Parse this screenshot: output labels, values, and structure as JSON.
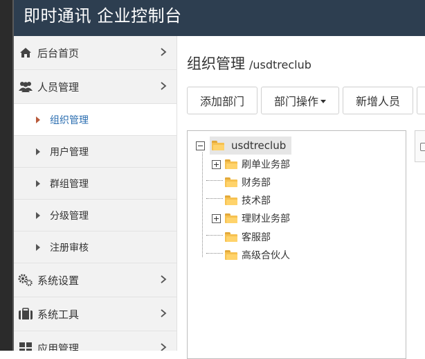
{
  "header": {
    "title": "即时通讯 企业控制台"
  },
  "sidebar": {
    "items": [
      {
        "label": "后台首页",
        "icon": "home-icon"
      },
      {
        "label": "人员管理",
        "icon": "users-icon"
      }
    ],
    "sub_items": [
      {
        "label": "组织管理",
        "active": true
      },
      {
        "label": "用户管理"
      },
      {
        "label": "群组管理"
      },
      {
        "label": "分级管理"
      },
      {
        "label": "注册审核"
      }
    ],
    "bottom_items": [
      {
        "label": "系统设置",
        "icon": "gears-icon"
      },
      {
        "label": "系统工具",
        "icon": "briefcase-icon"
      },
      {
        "label": "应用管理",
        "icon": "grid-icon"
      }
    ]
  },
  "main": {
    "title": "组织管理",
    "subtitle": "/usdtreclub",
    "buttons": {
      "add_dept": "添加部门",
      "dept_ops": "部门操作",
      "add_person": "新增人员"
    },
    "tree": {
      "root": "usdtreclub",
      "children": [
        "刷单业务部",
        "财务部",
        "技术部",
        "理财业务部",
        "客服部",
        "高级合伙人"
      ]
    }
  },
  "colors": {
    "header_bg": "#2d3e50",
    "active_link": "#2a6db0",
    "folder": "#f6c150"
  }
}
